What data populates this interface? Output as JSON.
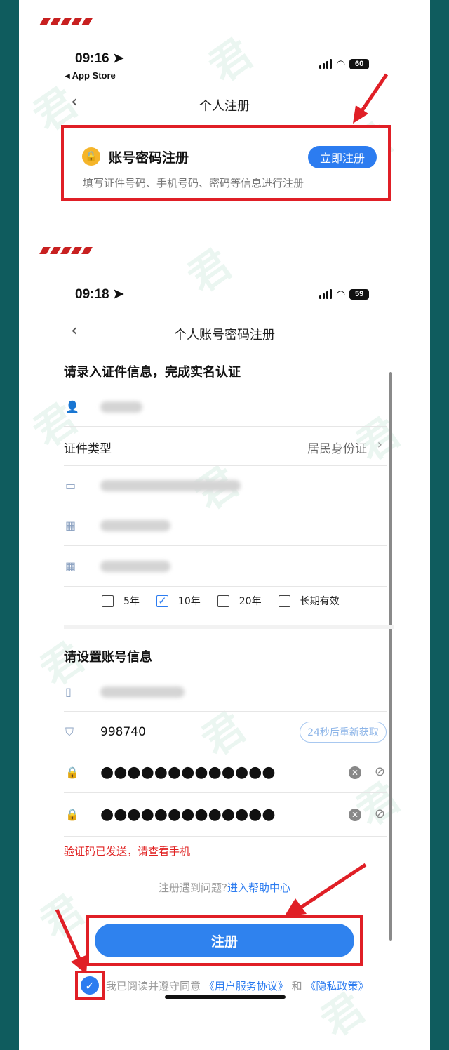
{
  "screen1": {
    "time": "09:16",
    "back_app": "◂ App Store",
    "battery": "60",
    "title": "个人注册",
    "card": {
      "title": "账号密码注册",
      "button": "立即注册",
      "description": "填写证件号码、手机号码、密码等信息进行注册"
    }
  },
  "screen2": {
    "time": "09:18",
    "battery": "59",
    "title": "个人账号密码注册",
    "section_identity": "请录入证件信息，完成实名认证",
    "id_type_label": "证件类型",
    "id_type_value": "居民身份证",
    "periods": [
      {
        "label": "5年",
        "checked": false
      },
      {
        "label": "10年",
        "checked": true
      },
      {
        "label": "20年",
        "checked": false
      },
      {
        "label": "长期有效",
        "checked": false
      }
    ],
    "section_account": "请设置账号信息",
    "code_value": "998740",
    "code_button": "24秒后重新获取",
    "password_mask": "●●●●●●●●●●●●●",
    "confirm_mask": "●●●●●●●●●●●●●",
    "error_message": "验证码已发送，请查看手机",
    "help_prefix": "注册遇到问题?",
    "help_link": "进入帮助中心",
    "register_button": "注册",
    "agree_prefix": "我已阅读并遵守同意",
    "agree_link1": "《用户服务协议》",
    "agree_and": "和",
    "agree_link2": "《隐私政策》"
  },
  "colors": {
    "accent": "#2c7cf0",
    "highlight_frame": "#e01f26",
    "background": "#0f5c5e"
  }
}
